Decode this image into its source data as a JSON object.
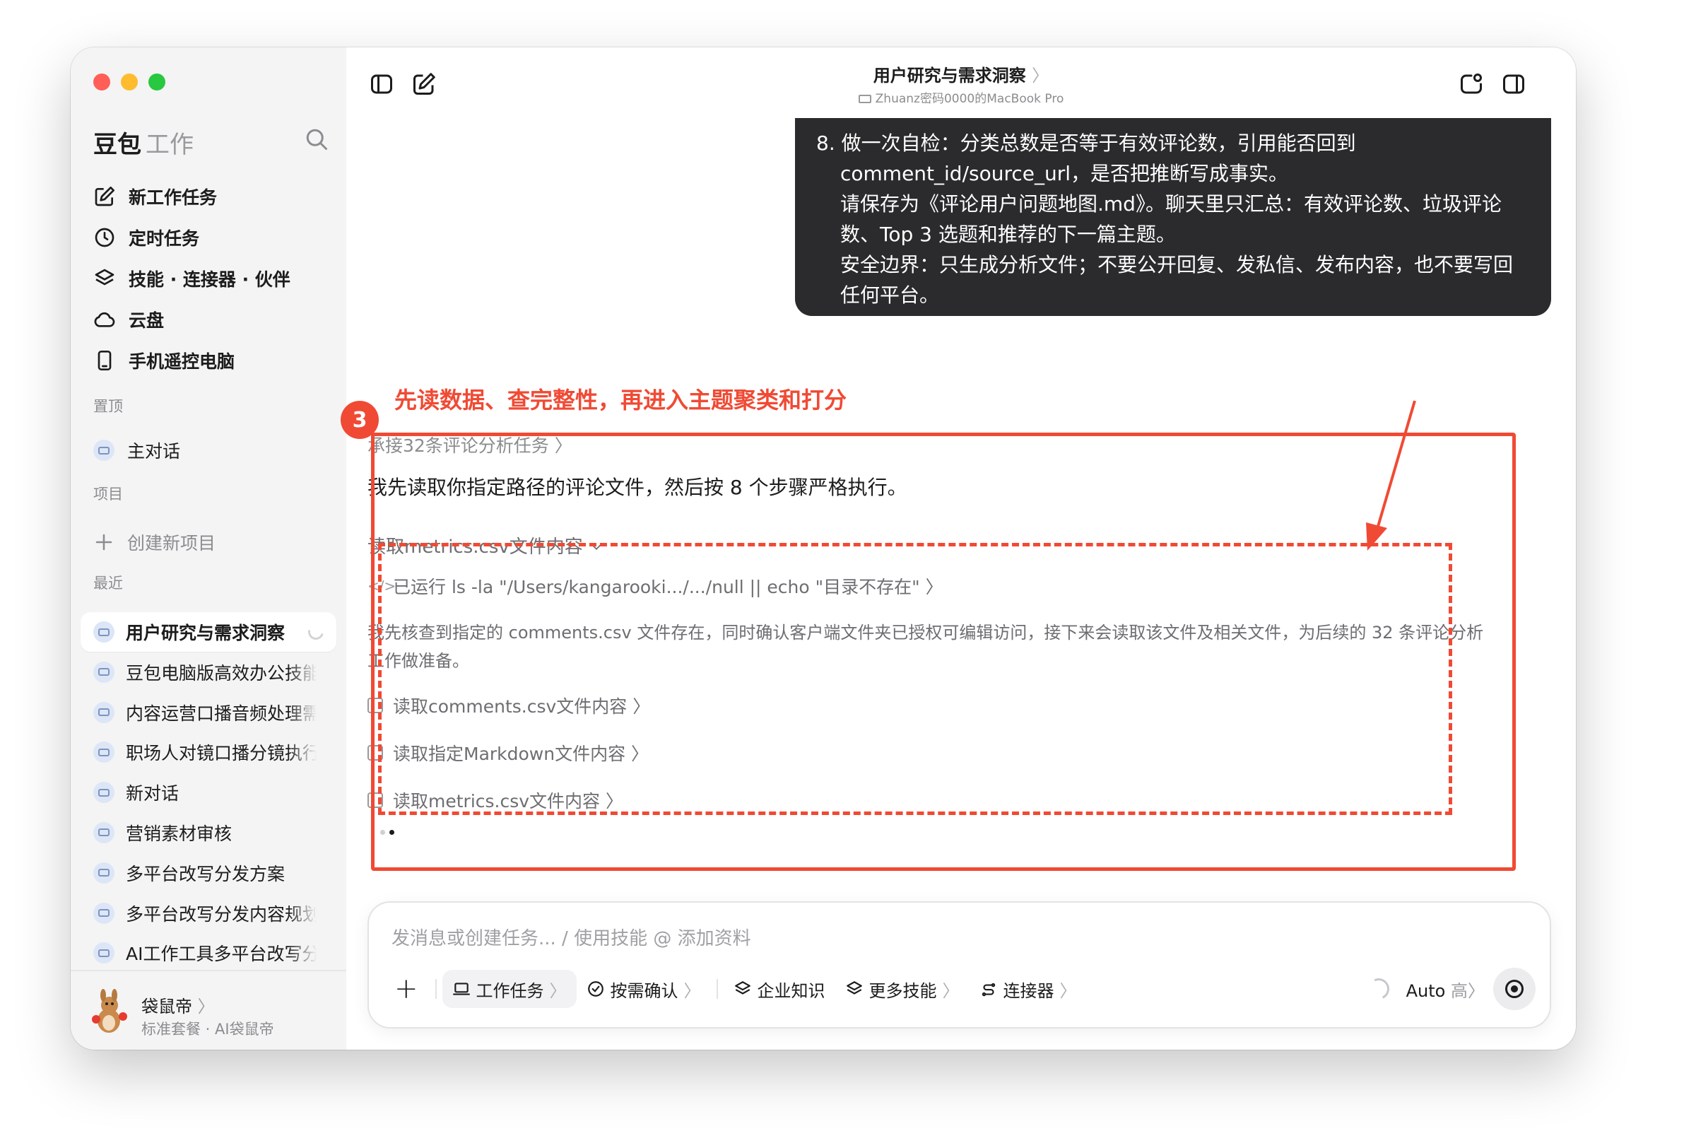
{
  "sidebar": {
    "brand": "豆包",
    "brand_sub": "工作",
    "nav": [
      "新工作任务",
      "定时任务",
      "技能 · 连接器 · 伙伴",
      "云盘",
      "手机遥控电脑"
    ],
    "pinned_label": "置顶",
    "pinned_item": "主对话",
    "projects_label": "项目",
    "new_project": "创建新项目",
    "recent_label": "最近",
    "recent": [
      "用户研究与需求洞察",
      "豆包电脑版高效办公技能",
      "内容运营口播音频处理需求",
      "职场人对镜口播分镜执行",
      "新对话",
      "营销素材审核",
      "多平台改写分发方案",
      "多平台改写分发内容规划",
      "AI工作工具多平台改写分发"
    ],
    "user_name": "袋鼠帝",
    "user_plan": "标准套餐 · AI袋鼠帝"
  },
  "header": {
    "title": "用户研究与需求洞察",
    "chevron": "〉",
    "device": "Zhuanz密码0000的MacBook Pro"
  },
  "user_message": {
    "lines": [
      "8. 做一次自检：分类总数是否等于有效评论数，引用能否回到",
      "comment_id/source_url，是否把推断写成事实。",
      "请保存为《评论用户问题地图.md》。聊天里只汇总：有效评论数、垃圾评论",
      "数、Top 3 选题和推荐的下一篇主题。",
      "安全边界：只生成分析文件；不要公开回复、发私信、发布内容，也不要写回",
      "任何平台。"
    ]
  },
  "annotation": {
    "number": "3",
    "title": "先读数据、查完整性，再进入主题聚类和打分",
    "color": "#f04a34"
  },
  "assistant": {
    "task_link": "承接32条评论分析任务 〉",
    "intro": "我先读取你指定路径的评论文件，然后按 8 个步骤严格执行。",
    "section": "读取metrics.csv文件内容",
    "ran_cmd": "已运行 ls -la \"/Users/kangarooki.../.../null || echo \"目录不存在\" 〉",
    "note": "我先核查到指定的 comments.csv 文件存在，同时确认客户端文件夹已授权可编辑访问，接下来会读取该文件及相关文件，为后续的 32 条评论分析工作做准备。",
    "tools": [
      "读取comments.csv文件内容 〉",
      "读取指定Markdown文件内容 〉",
      "读取metrics.csv文件内容 〉"
    ]
  },
  "composer": {
    "placeholder": "发消息或创建任务... / 使用技能 @ 添加资料",
    "buttons": {
      "plus": "+",
      "work_task": "工作任务",
      "confirm": "按需确认",
      "knowledge": "企业知识",
      "more_skills": "更多技能",
      "connectors": "连接器"
    },
    "chevron": "〉",
    "mode": "Auto",
    "mode_level": "高"
  }
}
